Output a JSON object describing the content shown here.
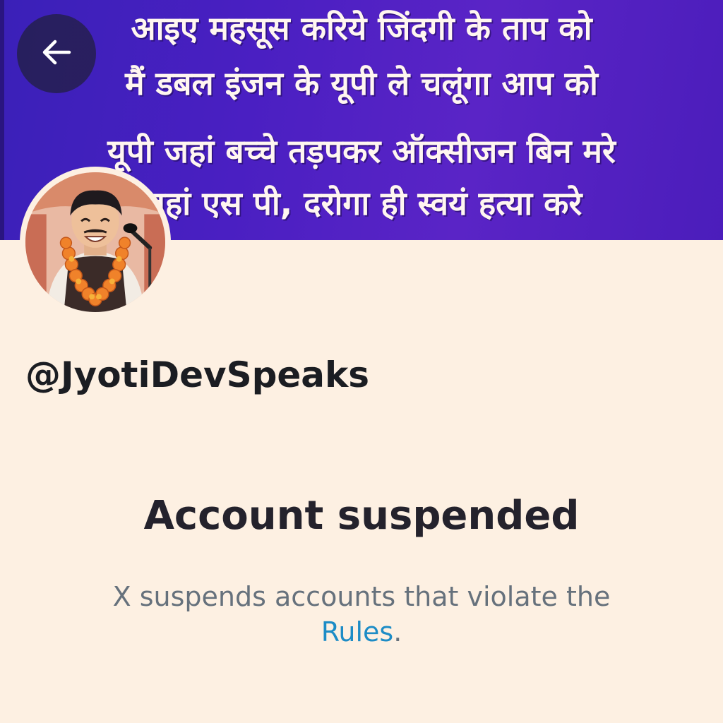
{
  "header": {
    "banner_lines": [
      "आइए महसूस करिये जिंदगी के ताप को",
      "मैं डबल इंजन के यूपी ले चलूंगा आप को",
      "यूपी जहां बच्चे तड़पकर ऑक्सीजन बिन मरे",
      "जहां एस पी, दरोगा ही स्वयं हत्या करे"
    ],
    "back_icon": "arrow-left-icon"
  },
  "profile": {
    "handle": "@JyotiDevSpeaks",
    "avatar_icon": "profile-avatar"
  },
  "notice": {
    "title": "Account suspended",
    "message_prefix": "X suspends accounts that violate the",
    "link_text": "Rules",
    "message_suffix": "."
  },
  "colors": {
    "background": "#fdf0e2",
    "banner": "#4a1fc2",
    "link": "#1d8cc6",
    "muted_text": "#66717c"
  }
}
